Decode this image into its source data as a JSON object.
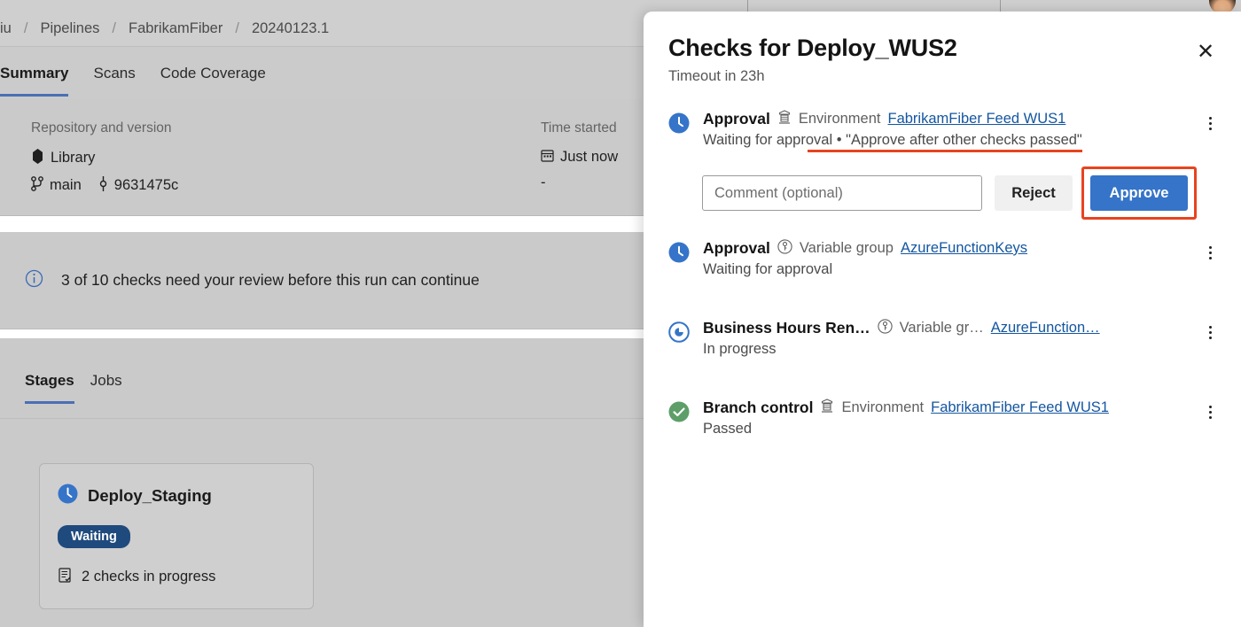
{
  "breadcrumb": {
    "items": [
      "iu",
      "Pipelines",
      "FabrikamFiber",
      "20240123.1"
    ],
    "separator": "/"
  },
  "tabs": [
    {
      "label": "Summary",
      "active": true
    },
    {
      "label": "Scans",
      "active": false
    },
    {
      "label": "Code Coverage",
      "active": false
    }
  ],
  "summary": {
    "repository": {
      "label": "Repository and version",
      "name": "Library",
      "name_icon": "azure-repos-icon",
      "branch": "main",
      "branch_icon": "branch-icon",
      "commit": "9631475c",
      "commit_icon": "commit-icon"
    },
    "time": {
      "label": "Time started",
      "started": "Just now",
      "started_icon": "calendar-icon",
      "elapsed": "-"
    }
  },
  "info_banner": {
    "icon": "info-icon",
    "text": "3 of 10 checks need your review before this run can continue"
  },
  "stages_section": {
    "tabs": [
      {
        "label": "Stages",
        "active": true
      },
      {
        "label": "Jobs",
        "active": false
      }
    ],
    "card": {
      "icon": "clock-blue-icon",
      "title": "Deploy_Staging",
      "badge": "Waiting",
      "checks_icon": "checklist-icon",
      "checks_text": "2 checks in progress"
    }
  },
  "panel": {
    "title": "Checks for Deploy_WUS2",
    "subtitle": "Timeout in 23h",
    "close_label": "✕",
    "checks": [
      {
        "icon": "clock-blue-icon",
        "name": "Approval",
        "resource_icon": "environment-icon",
        "resource_type": "Environment",
        "resource_link": "FabrikamFiber Feed WUS1",
        "status": "Waiting for approval",
        "separator": "•",
        "instruction": "\"Approve after other checks passed\"",
        "instruction_highlighted": true,
        "kebab": "more-options-icon",
        "has_actions": true
      },
      {
        "icon": "clock-blue-icon",
        "name": "Approval",
        "resource_icon": "variable-group-icon",
        "resource_type": "Variable group",
        "resource_link": "AzureFunctionKeys",
        "status": "Waiting for approval",
        "separator": "",
        "instruction": "",
        "instruction_highlighted": false,
        "kebab": "more-options-icon",
        "has_actions": false
      },
      {
        "icon": "in-progress-icon",
        "name": "Business Hours Ren…",
        "resource_icon": "variable-group-icon",
        "resource_type": "Variable gr…",
        "resource_link": "AzureFunction…",
        "status": "In progress",
        "separator": "",
        "instruction": "",
        "instruction_highlighted": false,
        "kebab": "more-options-icon",
        "has_actions": false
      },
      {
        "icon": "success-check-icon",
        "name": "Branch control",
        "resource_icon": "environment-icon",
        "resource_type": "Environment",
        "resource_link": "FabrikamFiber Feed WUS1",
        "status": "Passed",
        "separator": "",
        "instruction": "",
        "instruction_highlighted": false,
        "kebab": "more-options-icon",
        "has_actions": false
      }
    ],
    "actions": {
      "comment_placeholder": "Comment (optional)",
      "comment_value": "",
      "reject_label": "Reject",
      "approve_label": "Approve"
    }
  },
  "colors": {
    "accent_blue": "#3574c8",
    "link_blue": "#1456a0",
    "highlight_red": "#e8431f",
    "success_green": "#5e9e68",
    "waiting_badge": "#1f4a7d",
    "page_scrim": "#cacaca"
  }
}
